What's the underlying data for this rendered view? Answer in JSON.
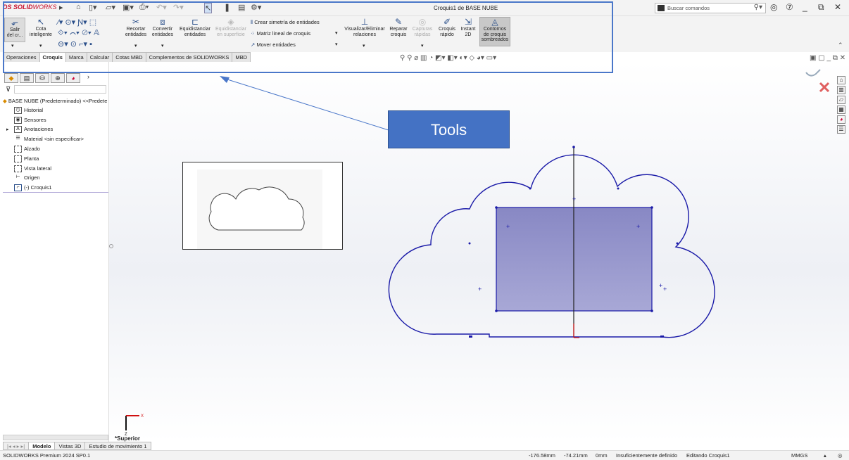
{
  "app": {
    "logo_ds": "DS",
    "logo_solid": "SOLID",
    "logo_works": "WORKS",
    "window_title": "Croquis1 de BASE NUBE",
    "search_placeholder": "Buscar comandos"
  },
  "ribbon": {
    "exit_sketch": "Salir\ndel cr...",
    "smart_dim": "Cota\ninteligente",
    "trim": "Recortar\nentidades",
    "convert": "Convertir\nentidades",
    "offset": "Equidistanciar\nentidades",
    "offset_surface": "Equidistanciar\nen superficie",
    "mirror": "Crear simetría de entidades",
    "linear_pattern": "Matriz lineal de croquis",
    "move": "Mover entidades",
    "relations": "Visualizar/Eliminar\nrelaciones",
    "repair": "Reparar\ncroquis",
    "quick_snaps": "Capturas\nrápidas",
    "rapid_sketch": "Croquis\nrápido",
    "instant2d": "Instant\n2D",
    "shaded_contours": "Contornos\nde croquis\nsombreados"
  },
  "tabs": [
    "Operaciones",
    "Croquis",
    "Marca",
    "Calcular",
    "Cotas MBD",
    "Complementos de SOLIDWORKS",
    "MBD"
  ],
  "tabs_selected": "Croquis",
  "tree": {
    "root": "BASE NUBE (Predeterminado) <<Predete",
    "items": [
      "Historial",
      "Sensores",
      "Anotaciones",
      "Material <sin especificar>",
      "Alzado",
      "Planta",
      "Vista lateral",
      "Origen",
      "(-) Croquis1"
    ]
  },
  "callout": {
    "label": "Tools"
  },
  "view": {
    "orientation": "*Superior"
  },
  "bottom_tabs": [
    "Modelo",
    "Vistas 3D",
    "Estudio de movimiento 1"
  ],
  "bottom_tabs_selected": "Modelo",
  "status": {
    "product": "SOLIDWORKS Premium 2024 SP0.1",
    "x": "-176.58mm",
    "y": "-74.21mm",
    "z": "0mm",
    "state": "Insuficientemente definido",
    "editing": "Editando Croquis1",
    "units": "MMGS"
  },
  "colors": {
    "sketch_blue": "#1a1aa8",
    "fill_rect": "#8e8ec8",
    "callout_bg": "#4472c4",
    "annotation_border": "#4a77c9"
  }
}
